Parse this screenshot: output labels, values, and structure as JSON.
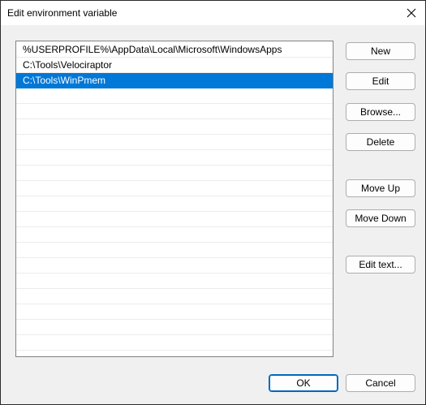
{
  "window": {
    "title": "Edit environment variable"
  },
  "list": {
    "items": [
      {
        "text": "%USERPROFILE%\\AppData\\Local\\Microsoft\\WindowsApps",
        "selected": false
      },
      {
        "text": "C:\\Tools\\Velociraptor",
        "selected": false
      },
      {
        "text": "C:\\Tools\\WinPmem",
        "selected": true
      }
    ]
  },
  "buttons": {
    "new": "New",
    "edit": "Edit",
    "browse": "Browse...",
    "delete": "Delete",
    "move_up": "Move Up",
    "move_down": "Move Down",
    "edit_text": "Edit text...",
    "ok": "OK",
    "cancel": "Cancel"
  },
  "icons": {
    "close": "close-icon"
  },
  "colors": {
    "selection": "#0078d7",
    "ok_border": "#0067c0"
  }
}
